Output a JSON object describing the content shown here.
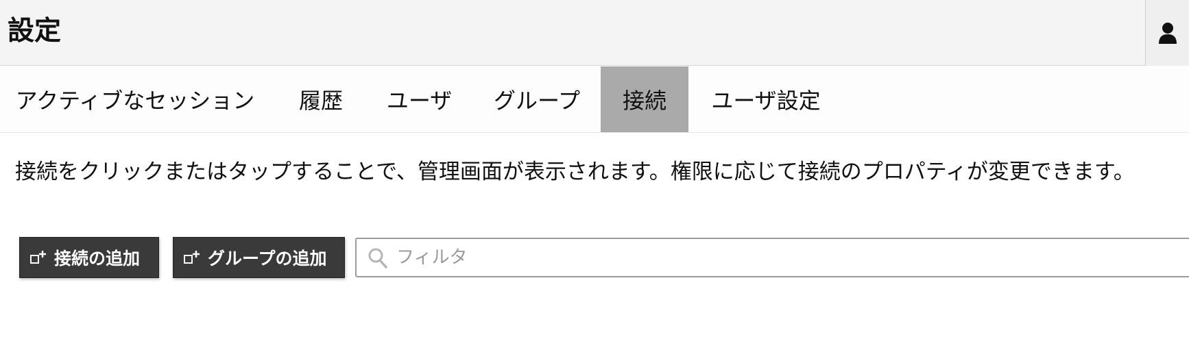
{
  "header": {
    "title": "設定"
  },
  "tabs": [
    {
      "label": "アクティブなセッション",
      "active": false
    },
    {
      "label": "履歴",
      "active": false
    },
    {
      "label": "ユーザ",
      "active": false
    },
    {
      "label": "グループ",
      "active": false
    },
    {
      "label": "接続",
      "active": true
    },
    {
      "label": "ユーザ設定",
      "active": false
    }
  ],
  "main": {
    "description": "接続をクリックまたはタップすることで、管理画面が表示されます。権限に応じて接続のプロパティが変更できます。",
    "add_connection_label": "接続の追加",
    "add_group_label": "グループの追加",
    "filter_placeholder": "フィルタ",
    "filter_value": ""
  },
  "icons": {
    "user": "user-icon",
    "add": "add-square-icon",
    "search": "search-icon"
  },
  "colors": {
    "header_bg": "#f4f4f4",
    "active_tab_bg": "#aaaaaa",
    "button_bg": "#3a3a3a",
    "button_text": "#ffffff"
  }
}
